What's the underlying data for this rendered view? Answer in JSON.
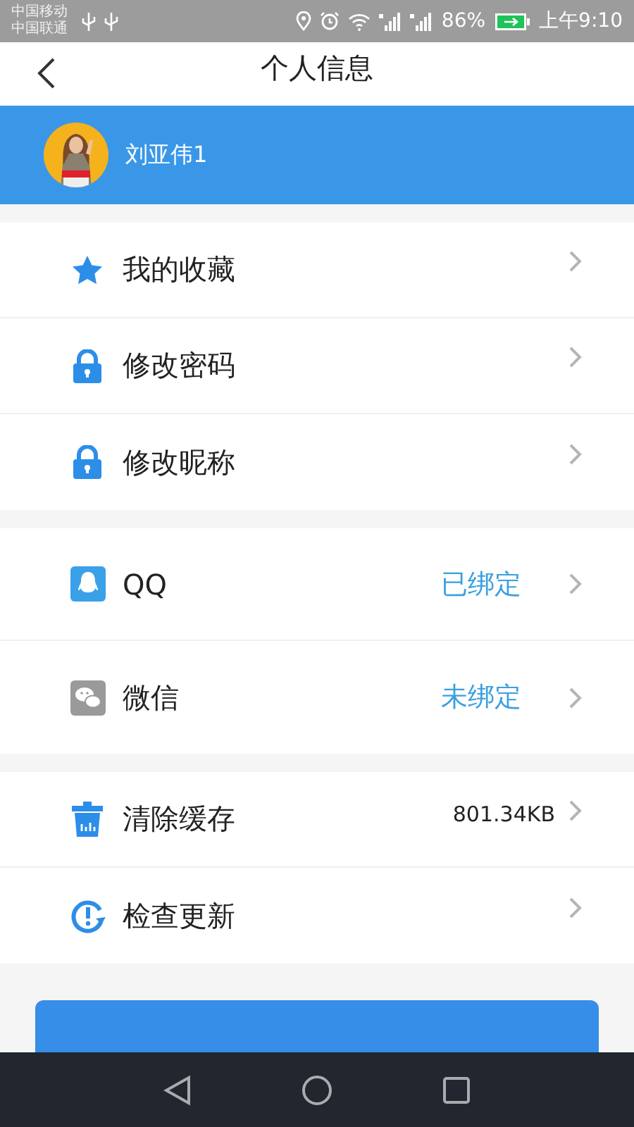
{
  "status_bar": {
    "carriers": [
      "中国移动",
      "中国联通"
    ],
    "battery_percent": "86%",
    "time": "上午9:10"
  },
  "header": {
    "title": "个人信息"
  },
  "profile": {
    "name": "刘亚伟1"
  },
  "groups": [
    {
      "rows": [
        {
          "kind": "link",
          "label": "我的收藏"
        },
        {
          "kind": "link",
          "label": "修改密码"
        },
        {
          "kind": "link",
          "label": "修改昵称"
        }
      ]
    },
    {
      "rows": [
        {
          "kind": "binding",
          "label": "QQ",
          "value": "已绑定"
        },
        {
          "kind": "binding",
          "label": "微信",
          "value": "未绑定"
        }
      ]
    },
    {
      "rows": [
        {
          "kind": "value",
          "label": "清除缓存",
          "value": "801.34KB"
        },
        {
          "kind": "link",
          "label": "检查更新"
        }
      ]
    }
  ],
  "logout_button": {
    "kind": "button"
  }
}
